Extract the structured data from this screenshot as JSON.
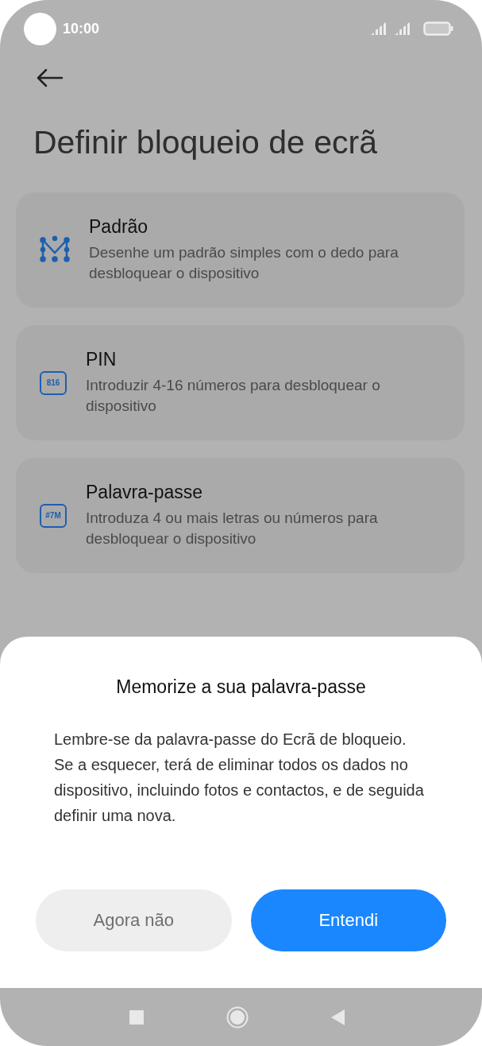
{
  "status_bar": {
    "time": "10:00"
  },
  "title": "Definir bloqueio de ecrã",
  "options": [
    {
      "kind": "pattern",
      "title": "Padrão",
      "description": "Desenhe um padrão simples com o dedo para desbloquear o dispositivo"
    },
    {
      "kind": "pin",
      "badge": "816",
      "title": "PIN",
      "description": "Introduzir 4-16 números para desbloquear o dispositivo"
    },
    {
      "kind": "password",
      "badge": "#7M",
      "title": "Palavra-passe",
      "description": "Introduza 4 ou mais letras ou números para desbloquear o dispositivo"
    }
  ],
  "dialog": {
    "title": "Memorize a sua palavra-passe",
    "message": "Lembre-se da palavra-passe do Ecrã de bloqueio. Se a esquecer, terá de eliminar todos os dados no dispositivo, incluindo fotos e contactos, e de seguida definir uma nova.",
    "buttons": [
      {
        "label": "Agora não",
        "kind": "secondary"
      },
      {
        "label": "Entendi",
        "kind": "primary"
      }
    ]
  }
}
